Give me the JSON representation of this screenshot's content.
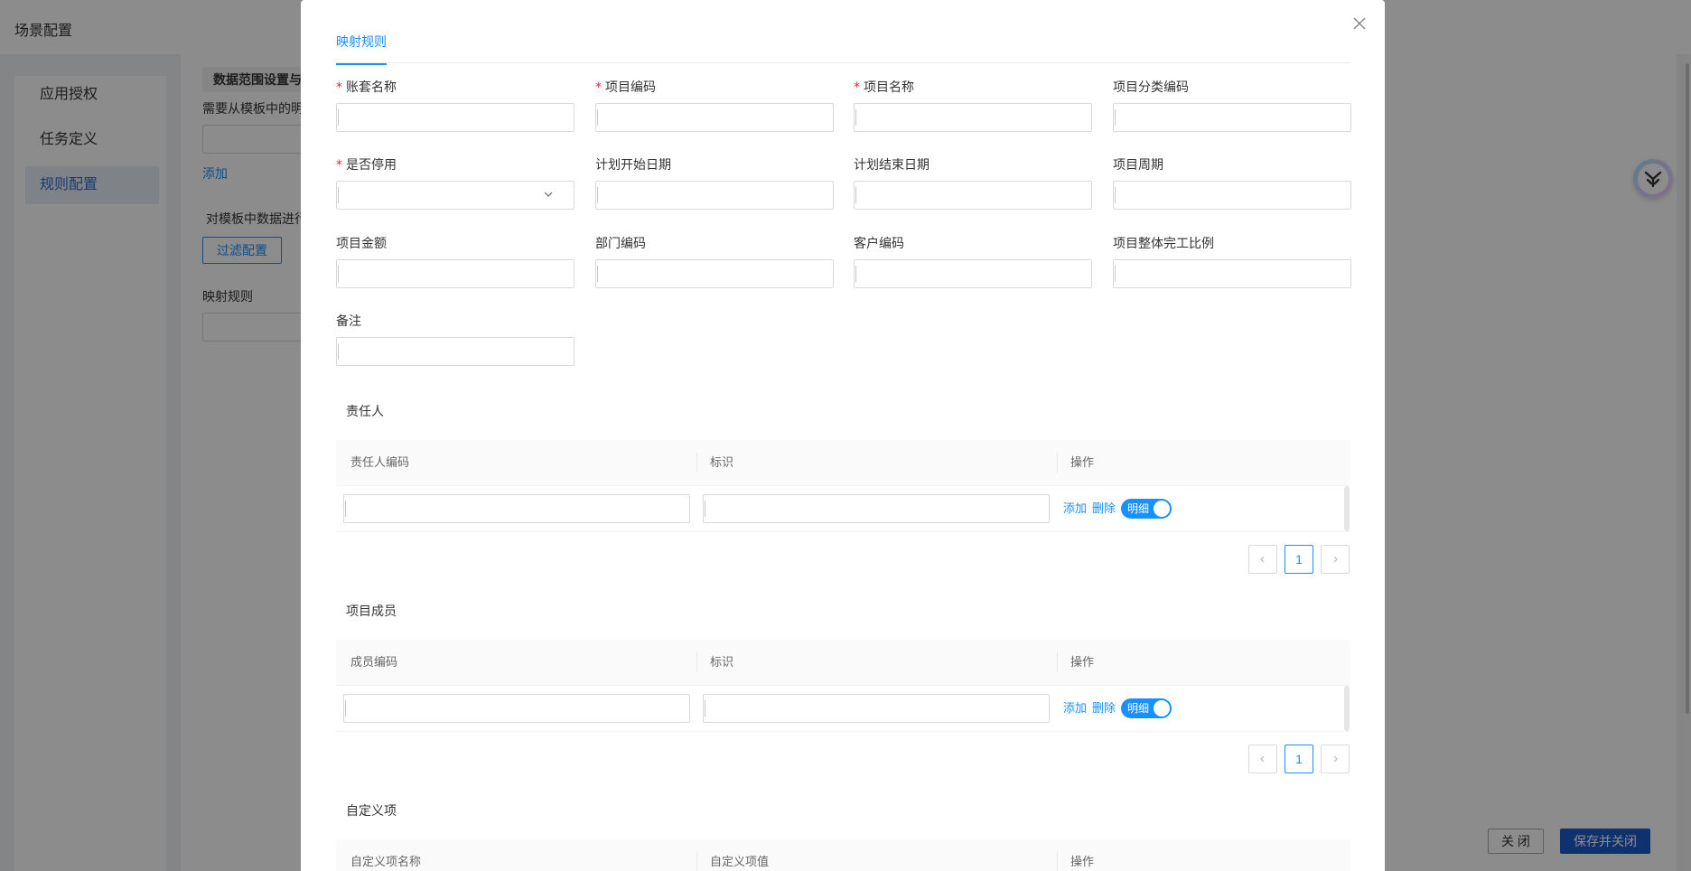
{
  "background": {
    "page_title": "场景配置",
    "sidebar": [
      {
        "label": "应用授权"
      },
      {
        "label": "任务定义"
      },
      {
        "label": "规则配置",
        "active": true
      }
    ],
    "section_header": "数据范围设置与过",
    "hint_text": "需要从模板中的明",
    "add_link": "添加",
    "filter_hint": "对模板中数据进行",
    "filter_button": "过滤配置",
    "mapping_label": "映射规则",
    "close_button": "关 闭",
    "save_close_button": "保存并关闭"
  },
  "modal": {
    "tab": "映射规则",
    "close_icon": "close-icon",
    "fields": [
      {
        "label": "账套名称",
        "required": true
      },
      {
        "label": "项目编码",
        "required": true
      },
      {
        "label": "项目名称",
        "required": true
      },
      {
        "label": "项目分类编码",
        "required": false
      },
      {
        "label": "是否停用",
        "required": true,
        "type": "select"
      },
      {
        "label": "计划开始日期",
        "required": false
      },
      {
        "label": "计划结束日期",
        "required": false
      },
      {
        "label": "项目周期",
        "required": false
      },
      {
        "label": "项目金额",
        "required": false
      },
      {
        "label": "部门编码",
        "required": false
      },
      {
        "label": "客户编码",
        "required": false
      },
      {
        "label": "项目整体完工比例",
        "required": false
      },
      {
        "label": "备注",
        "required": false
      }
    ],
    "responsible": {
      "title": "责任人",
      "columns": [
        "责任人编码",
        "标识",
        "操作"
      ],
      "row": {
        "add": "添加",
        "delete": "删除",
        "toggle": "明细"
      },
      "page": "1"
    },
    "members": {
      "title": "项目成员",
      "columns": [
        "成员编码",
        "标识",
        "操作"
      ],
      "row": {
        "add": "添加",
        "delete": "删除",
        "toggle": "明细"
      },
      "page": "1"
    },
    "custom": {
      "title": "自定义项",
      "columns": [
        "自定义项名称",
        "自定义项值",
        "操作"
      ]
    }
  }
}
